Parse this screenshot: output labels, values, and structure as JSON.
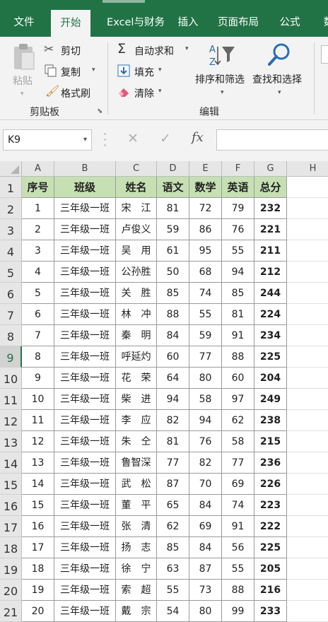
{
  "tabs": [
    "文件",
    "开始",
    "Excel与财务",
    "插入",
    "页面布局",
    "公式",
    "数"
  ],
  "ribbon": {
    "clipboard": {
      "paste": "粘贴",
      "cut": "剪切",
      "copy": "复制",
      "format_painter": "格式刷",
      "group_label": "剪贴板"
    },
    "editing": {
      "autosum": "自动求和",
      "fill": "填充",
      "clear": "清除",
      "sort_filter": "排序和筛选",
      "find_select": "查找和选择",
      "group_label": "编辑"
    }
  },
  "formula_bar": {
    "name_box": "K9",
    "fx_label": "fx",
    "formula": ""
  },
  "sheet": {
    "columns": [
      "A",
      "B",
      "C",
      "D",
      "E",
      "F",
      "G",
      "H"
    ],
    "row_numbers": [
      "1",
      "2",
      "3",
      "4",
      "5",
      "6",
      "7",
      "8",
      "9",
      "10",
      "11",
      "12",
      "13",
      "14",
      "15",
      "16",
      "17",
      "18",
      "19",
      "20",
      "21"
    ],
    "headers": [
      "序号",
      "班级",
      "姓名",
      "语文",
      "数学",
      "英语",
      "总分"
    ],
    "rows": [
      [
        "1",
        "三年级一班",
        "宋　江",
        "81",
        "72",
        "79",
        "232"
      ],
      [
        "2",
        "三年级一班",
        "卢俊义",
        "59",
        "86",
        "76",
        "221"
      ],
      [
        "3",
        "三年级一班",
        "吴　用",
        "61",
        "95",
        "55",
        "211"
      ],
      [
        "4",
        "三年级一班",
        "公孙胜",
        "50",
        "68",
        "94",
        "212"
      ],
      [
        "5",
        "三年级一班",
        "关　胜",
        "85",
        "74",
        "85",
        "244"
      ],
      [
        "6",
        "三年级一班",
        "林　冲",
        "88",
        "55",
        "81",
        "224"
      ],
      [
        "7",
        "三年级一班",
        "秦　明",
        "84",
        "59",
        "91",
        "234"
      ],
      [
        "8",
        "三年级一班",
        "呼延灼",
        "60",
        "77",
        "88",
        "225"
      ],
      [
        "9",
        "三年级一班",
        "花　荣",
        "64",
        "80",
        "60",
        "204"
      ],
      [
        "10",
        "三年级一班",
        "柴　进",
        "94",
        "58",
        "97",
        "249"
      ],
      [
        "11",
        "三年级一班",
        "李　应",
        "82",
        "94",
        "62",
        "238"
      ],
      [
        "12",
        "三年级一班",
        "朱　仝",
        "81",
        "76",
        "58",
        "215"
      ],
      [
        "13",
        "三年级一班",
        "鲁智深",
        "77",
        "82",
        "77",
        "236"
      ],
      [
        "14",
        "三年级一班",
        "武　松",
        "87",
        "70",
        "69",
        "226"
      ],
      [
        "15",
        "三年级一班",
        "董　平",
        "65",
        "84",
        "74",
        "223"
      ],
      [
        "16",
        "三年级一班",
        "张　清",
        "62",
        "69",
        "91",
        "222"
      ],
      [
        "17",
        "三年级一班",
        "扬　志",
        "85",
        "84",
        "56",
        "225"
      ],
      [
        "18",
        "三年级一班",
        "徐　宁",
        "63",
        "87",
        "55",
        "205"
      ],
      [
        "19",
        "三年级一班",
        "索　超",
        "55",
        "73",
        "88",
        "216"
      ],
      [
        "20",
        "三年级一班",
        "戴　宗",
        "54",
        "80",
        "99",
        "233"
      ]
    ],
    "selected_row": "9"
  },
  "colors": {
    "brand": "#217346",
    "header_fill": "#c6e0b4",
    "ribbon_bg": "#f3f3f3"
  }
}
